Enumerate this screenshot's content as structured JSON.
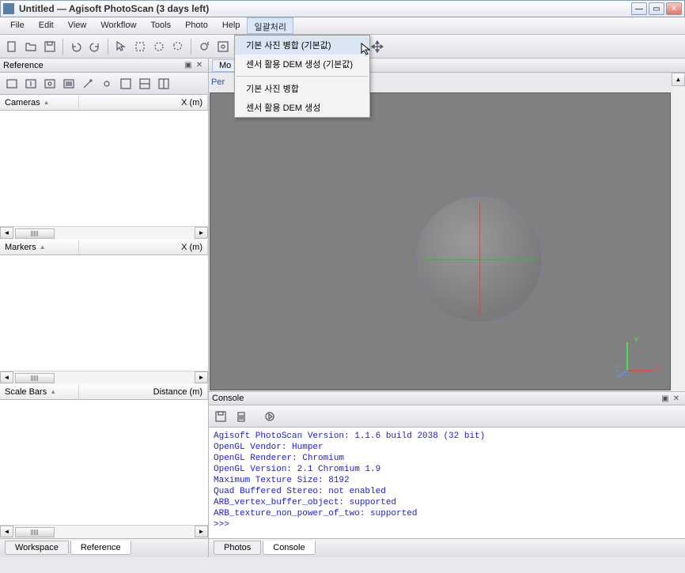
{
  "title": "Untitled — Agisoft PhotoScan (3 days left)",
  "menu": [
    "File",
    "Edit",
    "View",
    "Workflow",
    "Tools",
    "Photo",
    "Help",
    "일괄처리"
  ],
  "active_menu_index": 7,
  "dropdown": {
    "items": [
      "기본 사진 병합 (기본값)",
      "센서 활용 DEM 생성 (기본값)",
      "기본 사진 병합",
      "센서 활용 DEM 생성"
    ],
    "highlighted": 0,
    "sep_after": 1
  },
  "left": {
    "panel_title": "Reference",
    "sections": {
      "cameras": {
        "label": "Cameras",
        "col2": "X (m)"
      },
      "markers": {
        "label": "Markers",
        "col2": "X (m)"
      },
      "scalebars": {
        "label": "Scale Bars",
        "col2": "Distance (m)"
      }
    },
    "tabs": [
      "Workspace",
      "Reference"
    ],
    "active_tab": 1
  },
  "right": {
    "model_tab": "Mo",
    "axis": {
      "x": "X",
      "y": "Y",
      "z": "Z"
    },
    "per_label": "Per"
  },
  "console": {
    "title": "Console",
    "lines": [
      "Agisoft PhotoScan Version: 1.1.6 build 2038 (32 bit)",
      "OpenGL Vendor: Humper",
      "OpenGL Renderer: Chromium",
      "OpenGL Version: 2.1 Chromium 1.9",
      "Maximum Texture Size: 8192",
      "Quad Buffered Stereo: not enabled",
      "ARB_vertex_buffer_object: supported",
      "ARB_texture_non_power_of_two: supported",
      ">>>"
    ],
    "tabs": [
      "Photos",
      "Console"
    ],
    "active_tab": 1
  }
}
